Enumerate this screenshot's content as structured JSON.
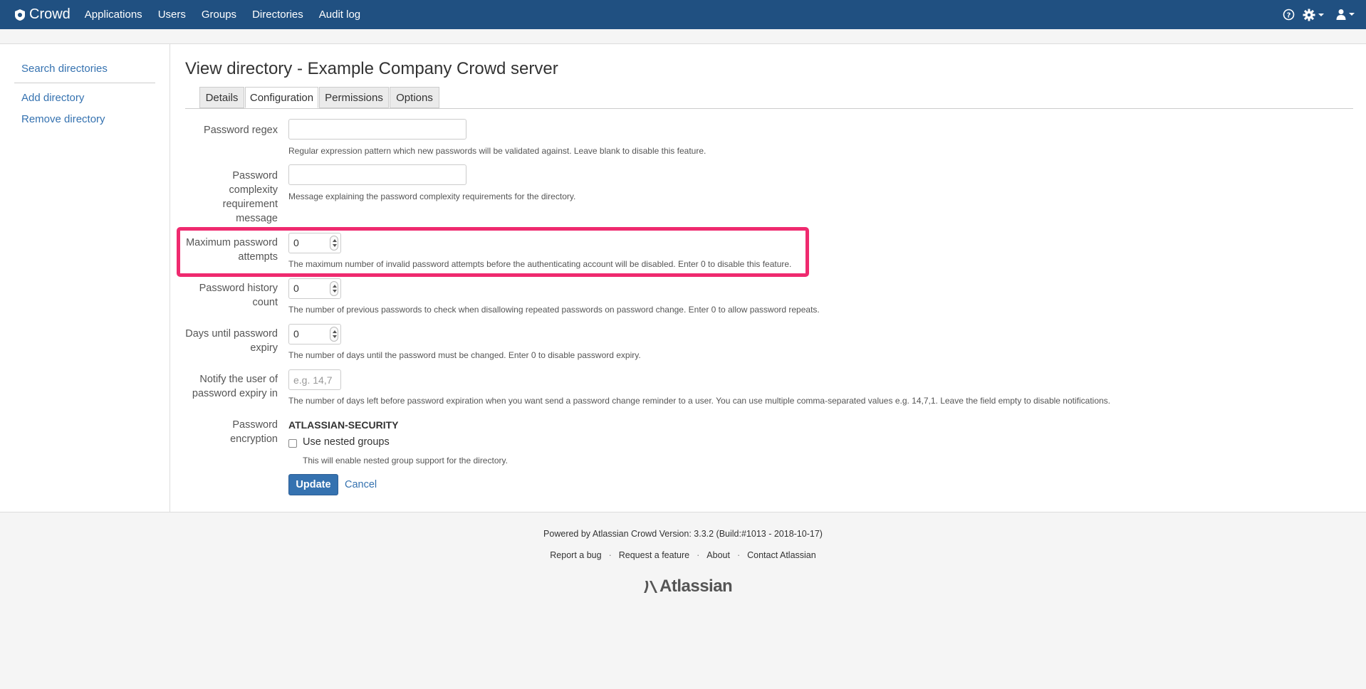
{
  "header": {
    "app_name": "Crowd",
    "nav": [
      "Applications",
      "Users",
      "Groups",
      "Directories",
      "Audit log"
    ],
    "icons": [
      "help-icon",
      "gear-icon",
      "user-icon"
    ],
    "bg_color": "#205081"
  },
  "sidebar": {
    "items": [
      {
        "label": "Search directories"
      },
      {
        "label": "Add directory"
      },
      {
        "label": "Remove directory"
      }
    ]
  },
  "page": {
    "title": "View directory - Example Company Crowd server",
    "tabs": [
      {
        "label": "Details",
        "active": false
      },
      {
        "label": "Configuration",
        "active": true
      },
      {
        "label": "Permissions",
        "active": false
      },
      {
        "label": "Options",
        "active": false
      }
    ]
  },
  "form": {
    "password_regex": {
      "label": "Password regex",
      "value": "",
      "help": "Regular expression pattern which new passwords will be validated against. Leave blank to disable this feature."
    },
    "complexity_message": {
      "label_lines": [
        "Password",
        "complexity",
        "requirement",
        "message"
      ],
      "value": "",
      "help": "Message explaining the password complexity requirements for the directory."
    },
    "max_attempts": {
      "label_lines": [
        "Maximum password",
        "attempts"
      ],
      "value": "0",
      "help": "The maximum number of invalid password attempts before the authenticating account will be disabled. Enter 0 to disable this feature."
    },
    "history_count": {
      "label_lines": [
        "Password history",
        "count"
      ],
      "value": "0",
      "help": "The number of previous passwords to check when disallowing repeated passwords on password change. Enter 0 to allow password repeats."
    },
    "days_expiry": {
      "label_lines": [
        "Days until password",
        "expiry"
      ],
      "value": "0",
      "help": "The number of days until the password must be changed. Enter 0 to disable password expiry."
    },
    "notify_expiry": {
      "label_lines": [
        "Notify the user of",
        "password expiry in"
      ],
      "placeholder": "e.g. 14,7",
      "help": "The number of days left before password expiration when you want send a password change reminder to a user. You can use multiple comma-separated values e.g. 14,7,1. Leave the field empty to disable notifications."
    },
    "encryption": {
      "label": "Password encryption",
      "value": "ATLASSIAN-SECURITY"
    },
    "nested_groups": {
      "label": "Use nested groups",
      "checked": false,
      "help": "This will enable nested group support for the directory."
    },
    "update_label": "Update",
    "cancel_label": "Cancel"
  },
  "footer": {
    "version": "Powered by Atlassian Crowd Version: 3.3.2 (Build:#1013 - 2018-10-17)",
    "links": [
      "Report a bug",
      "Request a feature",
      "About",
      "Contact Atlassian"
    ],
    "separator": "·",
    "brand": "Atlassian"
  },
  "highlight_color": "#ef2a6f"
}
